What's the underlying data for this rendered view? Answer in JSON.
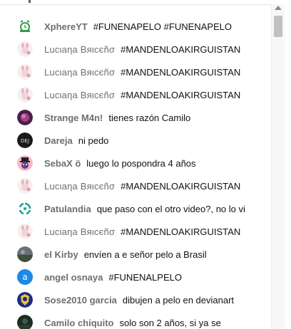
{
  "chat": {
    "messages": [
      {
        "author": "XphereYT",
        "text": "#FUNENAPELO #FUNENAPELO",
        "avatar": "alarm-clock-avatar"
      },
      {
        "author": "Lucιaηa Bяιcєñσ",
        "text": "#MANDENLOAKIRGUISTAN",
        "avatar": "bunny-avatar"
      },
      {
        "author": "Lucιaηa Bяιcєñσ",
        "text": "#MANDENLOAKIRGUISTAN",
        "avatar": "bunny-avatar"
      },
      {
        "author": "Lucιaηa Bяιcєñσ",
        "text": "#MANDENLOAKIRGUISTAN",
        "avatar": "bunny-avatar"
      },
      {
        "author": "Strange M4n!",
        "text": "tienes razón Camilo",
        "avatar": "purple-photo-avatar"
      },
      {
        "author": "Dareja",
        "text": "ni pedo",
        "avatar": "dark-logo-avatar"
      },
      {
        "author": "SebaX ö",
        "text": "luego lo pospondra 4 años",
        "avatar": "character-avatar"
      },
      {
        "author": "Lucιaηa Bяιcєñσ",
        "text": "#MANDENLOAKIRGUISTAN",
        "avatar": "bunny-avatar"
      },
      {
        "author": "Patulandia",
        "text": "que paso con el otro video?, no lo vi",
        "avatar": "teal-ring-avatar"
      },
      {
        "author": "Lucιaηa Bяιcєñσ",
        "text": "#MANDENLOAKIRGUISTAN",
        "avatar": "bunny-avatar"
      },
      {
        "author": "el Kirby",
        "text": "envíen a e señor pelo a Brasil",
        "avatar": "photo-avatar"
      },
      {
        "author": "angel osnaya",
        "text": "#FUNENALPELO",
        "avatar": "letter-avatar",
        "avatar_letter": "a"
      },
      {
        "author": "Sose2010 garcia",
        "text": "dibujen a pelo en devianart",
        "avatar": "badge-avatar"
      },
      {
        "author": "Camilo chiquito",
        "text": "solo son 2 años, si ya se",
        "avatar": "dark-photo-avatar"
      }
    ]
  },
  "colors": {
    "author": "#6e6e6e",
    "message": "#111111",
    "letter_avatar_bg": "#1e88e5",
    "scrollbar_thumb": "#c1c1c1"
  }
}
